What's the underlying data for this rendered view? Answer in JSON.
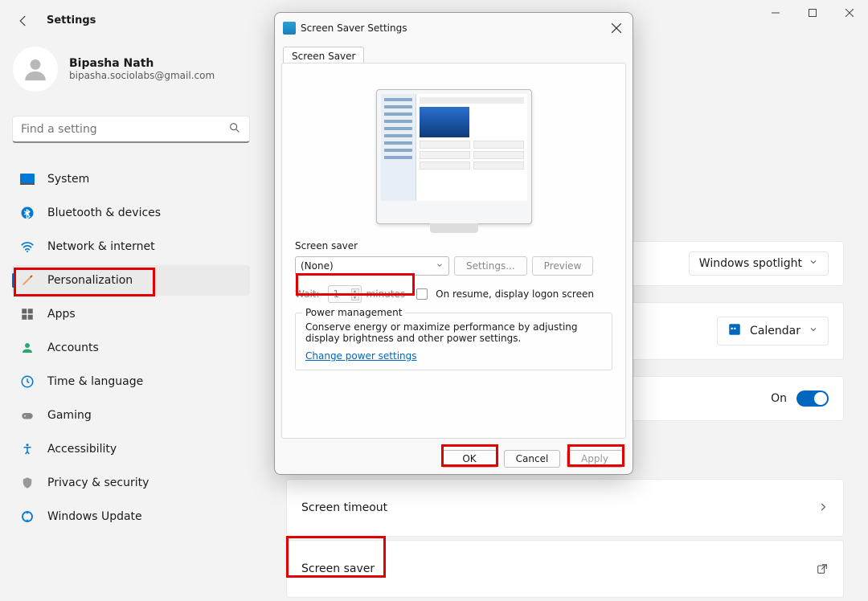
{
  "app_title": "Settings",
  "user": {
    "name": "Bipasha Nath",
    "email": "bipasha.sociolabs@gmail.com"
  },
  "search": {
    "placeholder": "Find a setting"
  },
  "nav": {
    "system": "System",
    "bluetooth": "Bluetooth & devices",
    "network": "Network & internet",
    "personalization": "Personalization",
    "apps": "Apps",
    "accounts": "Accounts",
    "time": "Time & language",
    "gaming": "Gaming",
    "accessibility": "Accessibility",
    "privacy": "Privacy & security",
    "update": "Windows Update"
  },
  "main": {
    "spotlight_option": "Windows spotlight",
    "calendar_label": "Calendar",
    "toggle_label": "On",
    "screen_timeout": "Screen timeout",
    "screen_saver": "Screen saver"
  },
  "dialog": {
    "title": "Screen Saver Settings",
    "tab": "Screen Saver",
    "section_label": "Screen saver",
    "combo_value": "(None)",
    "settings_btn": "Settings...",
    "preview_btn": "Preview",
    "wait_label": "Wait:",
    "wait_value": "1",
    "minutes": "minutes",
    "resume_label": "On resume, display logon screen",
    "pm_legend": "Power management",
    "pm_text": "Conserve energy or maximize performance by adjusting display brightness and other power settings.",
    "pm_link": "Change power settings",
    "ok": "OK",
    "cancel": "Cancel",
    "apply": "Apply"
  }
}
